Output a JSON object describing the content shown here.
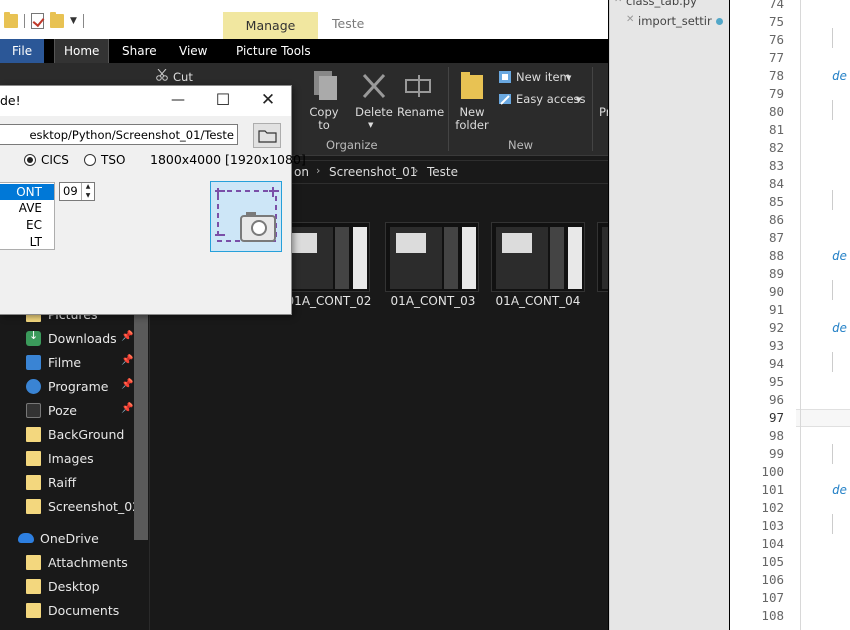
{
  "explorer": {
    "manage_tab": "Manage",
    "window_title": "Teste",
    "tabs": {
      "file": "File",
      "home": "Home",
      "share": "Share",
      "view": "View",
      "picture_tools": "Picture Tools"
    },
    "ribbon": {
      "cut": "Cut",
      "copy_to": "Copy to",
      "delete": "Delete",
      "rename": "Rename",
      "organize": "Organize",
      "new_folder": "New folder",
      "new_item": "New item",
      "easy_access": "Easy access",
      "new_group": "New",
      "properties_partial": "Pr"
    },
    "breadcrumb": [
      "on",
      "Screenshot_01",
      "Teste"
    ],
    "nav": [
      {
        "label": "Pictures",
        "icon": "pictures-icon",
        "pinned": false
      },
      {
        "label": "Downloads",
        "icon": "downloads-icon",
        "pinned": true
      },
      {
        "label": "Filme",
        "icon": "video-folder-icon",
        "pinned": true
      },
      {
        "label": "Programe",
        "icon": "program-folder-icon",
        "pinned": true
      },
      {
        "label": "Poze",
        "icon": "photo-folder-icon",
        "pinned": true
      },
      {
        "label": "BackGround",
        "icon": "folder-icon",
        "pinned": false
      },
      {
        "label": "Images",
        "icon": "folder-icon",
        "pinned": false
      },
      {
        "label": "Raiff",
        "icon": "folder-icon",
        "pinned": false
      },
      {
        "label": "Screenshot_02",
        "icon": "folder-icon",
        "pinned": false
      },
      {
        "label": "OneDrive",
        "icon": "onedrive-icon",
        "pinned": false
      },
      {
        "label": "Attachments",
        "icon": "folder-icon",
        "pinned": false
      },
      {
        "label": "Desktop",
        "icon": "folder-icon",
        "pinned": false
      },
      {
        "label": "Documents",
        "icon": "folder-icon",
        "pinned": false
      }
    ],
    "files": [
      "01A_CONT_02",
      "01A_CONT_03",
      "01A_CONT_04"
    ]
  },
  "dialog": {
    "title": "de!",
    "path_value": "esktop/Python/Screenshot_01/Teste",
    "radio_cics": "CICS",
    "radio_tso": "TSO",
    "resolution": "1800x4000 [1920x1080]",
    "list_items": [
      "ONT",
      "AVE",
      "EC",
      "LT"
    ],
    "list_selected_index": 0,
    "spin_value": "09"
  },
  "side_panel": {
    "files": [
      {
        "name": "class_tab.py",
        "modified": false
      },
      {
        "name": "import_settir",
        "modified": true
      }
    ]
  },
  "editor": {
    "line_numbers": [
      "74",
      "75",
      "76",
      "77",
      "78",
      "79",
      "80",
      "81",
      "82",
      "83",
      "84",
      "85",
      "86",
      "87",
      "88",
      "89",
      "90",
      "91",
      "92",
      "93",
      "94",
      "95",
      "96",
      "97",
      "98",
      "99",
      "100",
      "101",
      "102",
      "103",
      "104",
      "105",
      "106",
      "107",
      "108"
    ],
    "current_line": "97",
    "keyword_partial": "de"
  },
  "colors": {
    "accent_blue": "#0078d7",
    "manage_tab": "#f1e7a0",
    "file_tab": "#2b5797",
    "current_line_marker": "#f2c41a",
    "keyword": "#2a84c8"
  }
}
